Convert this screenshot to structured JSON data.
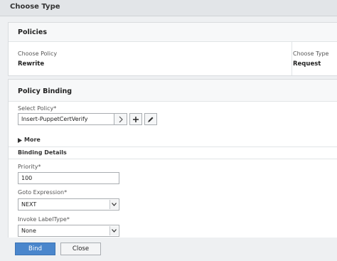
{
  "header": {
    "title": "Choose Type"
  },
  "policies": {
    "title": "Policies",
    "choose_policy_label": "Choose Policy",
    "choose_policy_value": "Rewrite",
    "choose_type_label": "Choose Type",
    "choose_type_value": "Request"
  },
  "binding": {
    "title": "Policy Binding",
    "select_policy_label": "Select Policy*",
    "select_policy_value": "Insert-PuppetCertVerify",
    "more_label": "More",
    "details_label": "Binding Details",
    "priority_label": "Priority*",
    "priority_value": "100",
    "goto_label": "Goto Expression*",
    "goto_value": "NEXT",
    "invoke_label": "Invoke LabelType*",
    "invoke_value": "None"
  },
  "footer": {
    "bind_label": "Bind",
    "close_label": "Close"
  }
}
